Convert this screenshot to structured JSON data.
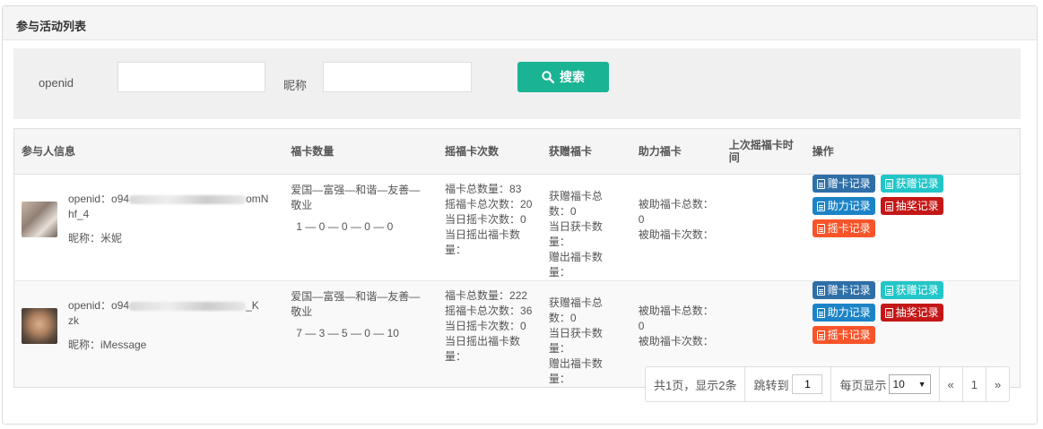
{
  "panel": {
    "title": "参与活动列表"
  },
  "search": {
    "openid_label": "openid",
    "openid_value": "",
    "nickname_label": "昵称",
    "nickname_value": "",
    "button_label": "搜索"
  },
  "table": {
    "headers": [
      "参与人信息",
      "福卡数量",
      "摇福卡次数",
      "获赠福卡",
      "助力福卡",
      "上次摇福卡时间",
      "操作"
    ],
    "rows": [
      {
        "openid_label": "openid：o94",
        "openid_suffix": "omN",
        "openid_tail": "hf_4",
        "nickname": "昵称：米妮",
        "cards_title": "爱国—富强—和谐—友善—敬业",
        "cards_counts": "1 — 0 — 0 — 0 — 0",
        "shake_total": "福卡总数量：83",
        "shake_count": "摇福卡总次数：20",
        "shake_today": "当日摇卡次数：0",
        "shake_today_cards": "当日摇出福卡数量：",
        "gift_total": "获赠福卡总数：0",
        "gift_today": "当日获卡数量：",
        "gift_out": "赠出福卡数量：",
        "help_total": "被助福卡总数：0",
        "help_count": "被助福卡次数：",
        "last_time": ""
      },
      {
        "openid_label": "openid：o94",
        "openid_suffix": "_K",
        "openid_tail": "zk",
        "nickname": "昵称：iMessage",
        "cards_title": "爱国—富强—和谐—友善—敬业",
        "cards_counts": "7 — 3 — 5 — 0 — 10",
        "shake_total": "福卡总数量：222",
        "shake_count": "摇福卡总次数：36",
        "shake_today": "当日摇卡次数：0",
        "shake_today_cards": "当日摇出福卡数量：",
        "gift_total": "获赠福卡总数：0",
        "gift_today": "当日获卡数量：",
        "gift_out": "赠出福卡数量：",
        "help_total": "被助福卡总数：0",
        "help_count": "被助福卡次数：",
        "last_time": ""
      }
    ],
    "actions": {
      "give_record": "赠卡记录",
      "received_record": "获赠记录",
      "help_record": "助力记录",
      "lottery_record": "抽奖记录",
      "shake_record": "摇卡记录"
    }
  },
  "pagination": {
    "summary": "共1页，显示2条",
    "jump_label": "跳转到",
    "jump_value": "1",
    "per_page_label": "每页显示",
    "per_page_value": "10",
    "prev": "«",
    "current_page": "1",
    "next": "»"
  },
  "colors": {
    "primary": "#1ab394",
    "navy": "#2f6fa8",
    "teal": "#23c6c8",
    "blue": "#1c84c6",
    "red": "#c41717",
    "orange": "#f8542a"
  }
}
